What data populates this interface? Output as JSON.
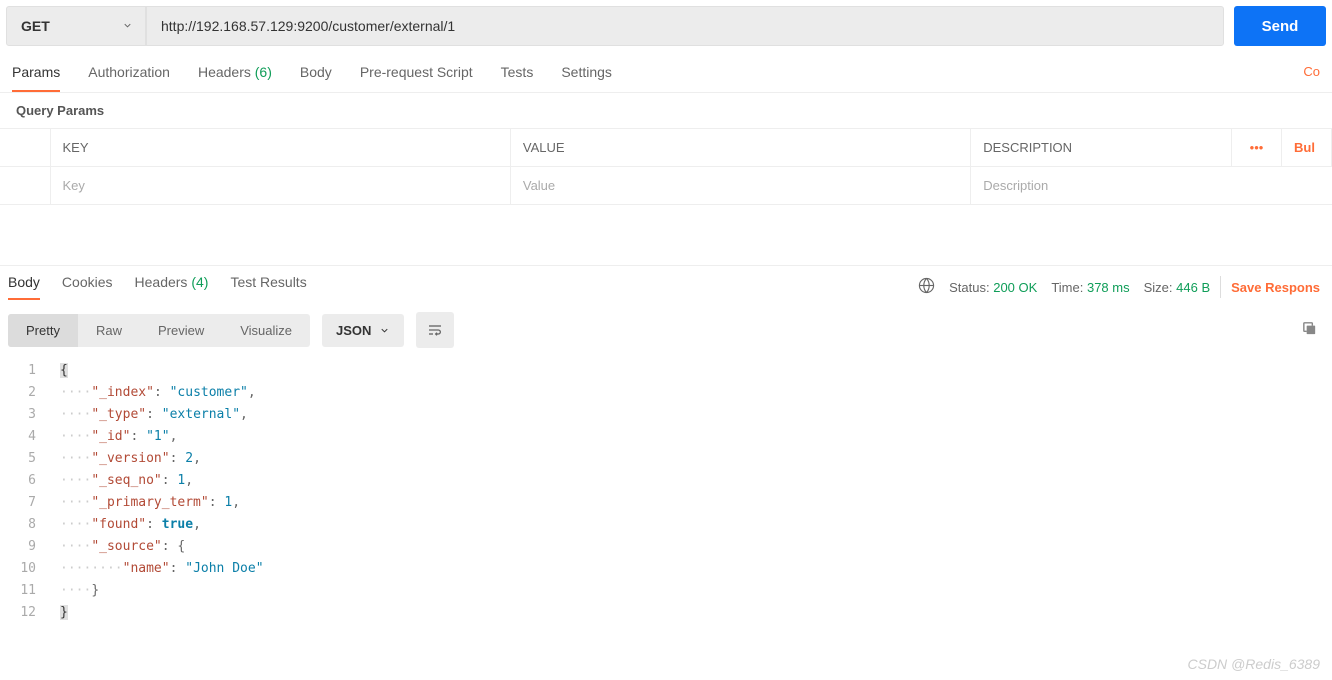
{
  "request": {
    "method": "GET",
    "url": "http://192.168.57.129:9200/customer/external/1",
    "sendLabel": "Send"
  },
  "reqTabs": {
    "params": "Params",
    "authorization": "Authorization",
    "headers": "Headers",
    "headersCount": "(6)",
    "body": "Body",
    "prerequest": "Pre-request Script",
    "tests": "Tests",
    "settings": "Settings",
    "code": "Co"
  },
  "queryParams": {
    "title": "Query Params",
    "colKey": "KEY",
    "colValue": "VALUE",
    "colDesc": "DESCRIPTION",
    "more": "•••",
    "bulk": "Bul",
    "placeholderKey": "Key",
    "placeholderValue": "Value",
    "placeholderDesc": "Description"
  },
  "respTabs": {
    "body": "Body",
    "cookies": "Cookies",
    "headers": "Headers",
    "headersCount": "(4)",
    "testResults": "Test Results"
  },
  "respMeta": {
    "statusLabel": "Status:",
    "statusValue": "200 OK",
    "timeLabel": "Time:",
    "timeValue": "378 ms",
    "sizeLabel": "Size:",
    "sizeValue": "446 B",
    "saveResponse": "Save Respons"
  },
  "viewBar": {
    "pretty": "Pretty",
    "raw": "Raw",
    "preview": "Preview",
    "visualize": "Visualize",
    "json": "JSON"
  },
  "responseBody": {
    "lines": [
      {
        "n": 1,
        "tokens": [
          {
            "t": "brace",
            "v": "{"
          }
        ]
      },
      {
        "n": 2,
        "tokens": [
          {
            "t": "dots",
            "v": "····"
          },
          {
            "t": "key",
            "v": "\"_index\""
          },
          {
            "t": "punct",
            "v": ": "
          },
          {
            "t": "str",
            "v": "\"customer\""
          },
          {
            "t": "punct",
            "v": ","
          }
        ]
      },
      {
        "n": 3,
        "tokens": [
          {
            "t": "dots",
            "v": "····"
          },
          {
            "t": "key",
            "v": "\"_type\""
          },
          {
            "t": "punct",
            "v": ": "
          },
          {
            "t": "str",
            "v": "\"external\""
          },
          {
            "t": "punct",
            "v": ","
          }
        ]
      },
      {
        "n": 4,
        "tokens": [
          {
            "t": "dots",
            "v": "····"
          },
          {
            "t": "key",
            "v": "\"_id\""
          },
          {
            "t": "punct",
            "v": ": "
          },
          {
            "t": "str",
            "v": "\"1\""
          },
          {
            "t": "punct",
            "v": ","
          }
        ]
      },
      {
        "n": 5,
        "tokens": [
          {
            "t": "dots",
            "v": "····"
          },
          {
            "t": "key",
            "v": "\"_version\""
          },
          {
            "t": "punct",
            "v": ": "
          },
          {
            "t": "num",
            "v": "2"
          },
          {
            "t": "punct",
            "v": ","
          }
        ]
      },
      {
        "n": 6,
        "tokens": [
          {
            "t": "dots",
            "v": "····"
          },
          {
            "t": "key",
            "v": "\"_seq_no\""
          },
          {
            "t": "punct",
            "v": ": "
          },
          {
            "t": "num",
            "v": "1"
          },
          {
            "t": "punct",
            "v": ","
          }
        ]
      },
      {
        "n": 7,
        "tokens": [
          {
            "t": "dots",
            "v": "····"
          },
          {
            "t": "key",
            "v": "\"_primary_term\""
          },
          {
            "t": "punct",
            "v": ": "
          },
          {
            "t": "num",
            "v": "1"
          },
          {
            "t": "punct",
            "v": ","
          }
        ]
      },
      {
        "n": 8,
        "tokens": [
          {
            "t": "dots",
            "v": "····"
          },
          {
            "t": "key",
            "v": "\"found\""
          },
          {
            "t": "punct",
            "v": ": "
          },
          {
            "t": "bool",
            "v": "true"
          },
          {
            "t": "punct",
            "v": ","
          }
        ]
      },
      {
        "n": 9,
        "tokens": [
          {
            "t": "dots",
            "v": "····"
          },
          {
            "t": "key",
            "v": "\"_source\""
          },
          {
            "t": "punct",
            "v": ": "
          },
          {
            "t": "punct",
            "v": "{"
          }
        ]
      },
      {
        "n": 10,
        "tokens": [
          {
            "t": "dots",
            "v": "········"
          },
          {
            "t": "key",
            "v": "\"name\""
          },
          {
            "t": "punct",
            "v": ": "
          },
          {
            "t": "str",
            "v": "\"John Doe\""
          }
        ]
      },
      {
        "n": 11,
        "tokens": [
          {
            "t": "dots",
            "v": "····"
          },
          {
            "t": "punct",
            "v": "}"
          }
        ]
      },
      {
        "n": 12,
        "tokens": [
          {
            "t": "brace",
            "v": "}"
          }
        ]
      }
    ]
  },
  "watermark": "CSDN @Redis_6389"
}
